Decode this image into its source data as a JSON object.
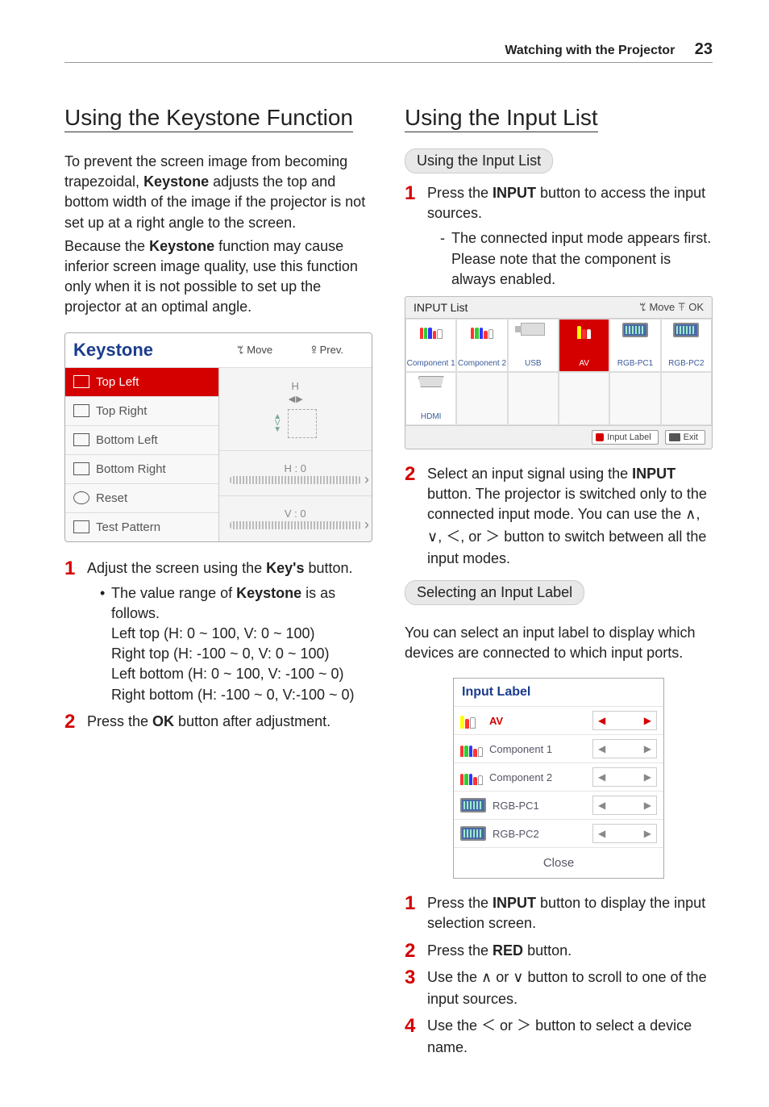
{
  "header": {
    "section_title": "Watching with the Projector",
    "page_number": "23"
  },
  "left": {
    "heading": "Using the Keystone Function",
    "para1": "To prevent the screen image from becoming trapezoidal, Keystone adjusts the top and bottom width of the image if the projector is not set up at a right angle to the screen.",
    "para2": "Because the Keystone function may cause inferior screen image quality, use this function only when it is not possible to set up the projector at an optimal angle.",
    "keystone_panel": {
      "title": "Keystone",
      "move_hint": "ꔂ Move",
      "prev_hint": "ꕉ  Prev.",
      "menu_items": [
        "Top Left",
        "Top Right",
        "Bottom Left",
        "Bottom Right",
        "Reset",
        "Test Pattern"
      ],
      "preview_h_label": "H",
      "preview_v_label": "V",
      "preview_h_value": "H : 0",
      "preview_v_value": "V : 0"
    },
    "step1": "Adjust the screen using the Key's button.",
    "bullet1": "The value range of Keystone is as follows.",
    "range_lines": [
      "Left top (H: 0 ~ 100, V: 0 ~ 100)",
      "Right top (H: -100 ~ 0, V: 0 ~ 100)",
      "Left bottom (H: 0 ~ 100, V: -100 ~ 0)",
      "Right bottom (H: -100 ~ 0, V:-100 ~ 0)"
    ],
    "step2": "Press the OK button after adjustment."
  },
  "right": {
    "heading": "Using the Input List",
    "sub1": "Using the Input List",
    "s1_step1": "Press the INPUT button to access the input sources.",
    "s1_dash": "The connected input mode appears first. Please note that the component is always enabled.",
    "inputlist_panel": {
      "title": "INPUT List",
      "hint": "ꔂ Move  ꔉ OK",
      "cells": [
        "Component 1",
        "Component 2",
        "USB",
        "AV",
        "RGB-PC1",
        "RGB-PC2",
        "HDMI"
      ],
      "active_cell": "AV",
      "footer_label": "Input Label",
      "footer_exit": "Exit"
    },
    "s1_step2": "Select an input signal using the INPUT button. The projector is switched only to the connected input mode. You can use the ∧, ∨, ＜, or ＞ button to switch between all the input modes.",
    "sub2": "Selecting an Input Label",
    "sub2_para": "You can select an input label to display which devices are connected to which input ports.",
    "inputlabel_panel": {
      "title": "Input Label",
      "rows": [
        "AV",
        "Component 1",
        "Component 2",
        "RGB-PC1",
        "RGB-PC2"
      ],
      "active_row": "AV",
      "close": "Close"
    },
    "s2_step1": "Press the INPUT button to display the input selection screen.",
    "s2_step2": "Press the RED button.",
    "s2_step3": "Use the ∧ or ∨ button to scroll to one of the input sources.",
    "s2_step4": "Use the ＜ or ＞ button  to select a device name."
  },
  "bold_words": [
    "Keystone",
    "Keystone",
    "Key's",
    "Keystone",
    "OK",
    "INPUT",
    "INPUT",
    "INPUT",
    "RED"
  ]
}
